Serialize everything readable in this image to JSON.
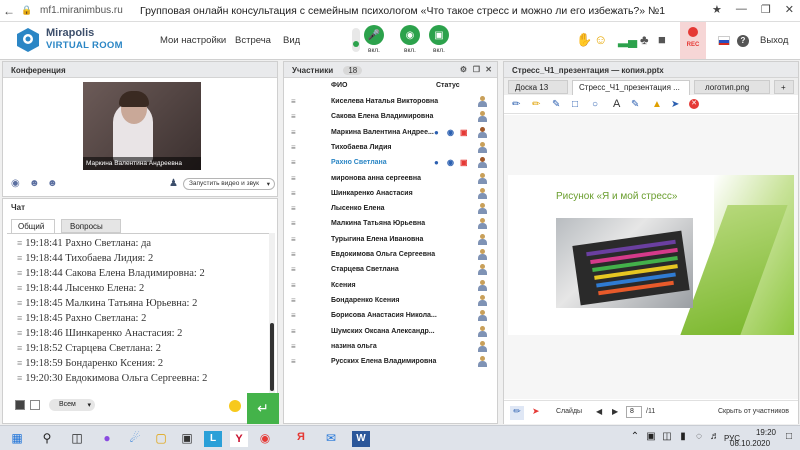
{
  "browser": {
    "url": "mf1.miranimbus.ru",
    "page_title": "Групповая онлайн консультация с семейным психологом «Что такое стресс и можно ли его избежать?» №1"
  },
  "app": {
    "logo_line1": "Mirapolis",
    "logo_line2": "VIRTUAL ROOM",
    "menu": [
      "Мои настройки",
      "Встреча",
      "Вид"
    ],
    "mic_label": "вкл.",
    "cam_label": "вкл.",
    "screen_label": "вкл.",
    "rec_label": "REC",
    "exit_label": "Выход"
  },
  "conference": {
    "title": "Конференция",
    "video_name": "Маркина Валентина Андреевна",
    "start_video_button": "Запустить видео и звук"
  },
  "chat": {
    "title": "Чат",
    "tabs": [
      "Общий",
      "Вопросы"
    ],
    "messages": [
      "19:18:41 Рахно Светлана: да",
      "19:18:44 Тихобаева Лидия: 2",
      "19:18:44 Сакова Елена Владимировна: 2",
      "19:18:44 Лысенко Елена: 2",
      "19:18:45 Малкина Татьяна Юрьевна: 2",
      "19:18:45 Рахно Светлана: 2",
      "19:18:46 Шинкаренко Анастасия: 2",
      "19:18:52 Старцева Светлана: 2",
      "19:18:59 Бондаренко Ксения: 2",
      "19:20:30 Евдокимова Ольга Сергеевна: 2"
    ],
    "recipient": "Всем"
  },
  "participants": {
    "title": "Участники",
    "count": "18",
    "col_name": "ФИО",
    "col_status": "Статус",
    "list": [
      "Киселева Наталья Викторовна",
      "Сакова Елена Владимировна",
      "Маркина Валентина Андрее...",
      "Тихобаева Лидия",
      "Рахно Светлана",
      "миронова анна сергеевна",
      "Шинкаренко Анастасия",
      "Лысенко Елена",
      "Малкина Татьяна Юрьевна",
      "Турыгина Елена Ивановна",
      "Евдокимова Ольга Сергеевна",
      "Старцева Светлана",
      "Ксения",
      "Бондаренко Ксения",
      "Борисова Анастасия Никола...",
      "Шумских Оксана Александр...",
      "назина ольга",
      "Русских Елена Владимировна"
    ]
  },
  "presentation": {
    "title": "Стресс_Ч1_презентация — копия.pptx",
    "tabs": [
      "Доска 13",
      "Стресс_Ч1_презентация ...",
      "логотип.png",
      "+"
    ],
    "slide_heading": "Рисунок «Я и мой стресс»",
    "slides_label": "Слайды",
    "current_slide": "8",
    "total_slides": "/11",
    "hide_label": "Скрыть от участников"
  },
  "taskbar": {
    "lang": "РУС",
    "time": "19:20",
    "date": "08.10.2020"
  },
  "colors": {
    "accent_green": "#2ca24c",
    "link_blue": "#2b86c5",
    "slide_green": "#8dc63f"
  }
}
